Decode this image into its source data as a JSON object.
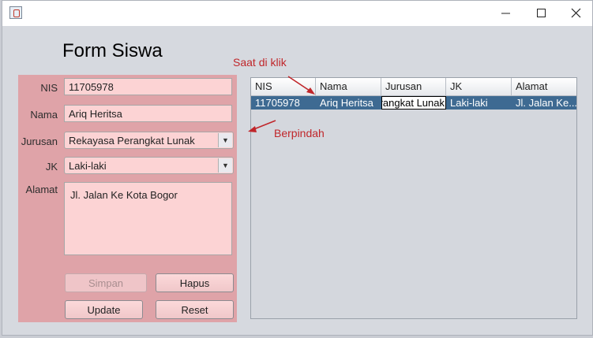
{
  "form": {
    "title": "Form Siswa",
    "labels": {
      "nis": "NIS",
      "nama": "Nama",
      "jurusan": "Jurusan",
      "jk": "JK",
      "alamat": "Alamat"
    },
    "values": {
      "nis": "11705978",
      "nama": "Ariq Heritsa",
      "jurusan": "Rekayasa Perangkat Lunak",
      "jk": "Laki-laki",
      "alamat": "Jl. Jalan Ke Kota Bogor"
    },
    "buttons": {
      "simpan": "Simpan",
      "hapus": "Hapus",
      "update": "Update",
      "reset": "Reset"
    }
  },
  "table": {
    "columns": [
      "NIS",
      "Nama",
      "Jurusan",
      "JK",
      "Alamat"
    ],
    "rows": [
      [
        "11705978",
        "Ariq Heritsa",
        "rangkat Lunak",
        "Laki-laki",
        "Jl. Jalan Ke..."
      ]
    ]
  },
  "annotations": {
    "click": "Saat di klik",
    "moved": "Berpindah"
  },
  "colors": {
    "panel": "#dfa3a8",
    "field": "#fcd3d4",
    "selected_row": "#3e6a92",
    "annotation": "#c0262a"
  },
  "icons": {
    "app": "java-icon",
    "minimize": "minimize-icon",
    "maximize": "maximize-icon",
    "close": "close-icon"
  }
}
